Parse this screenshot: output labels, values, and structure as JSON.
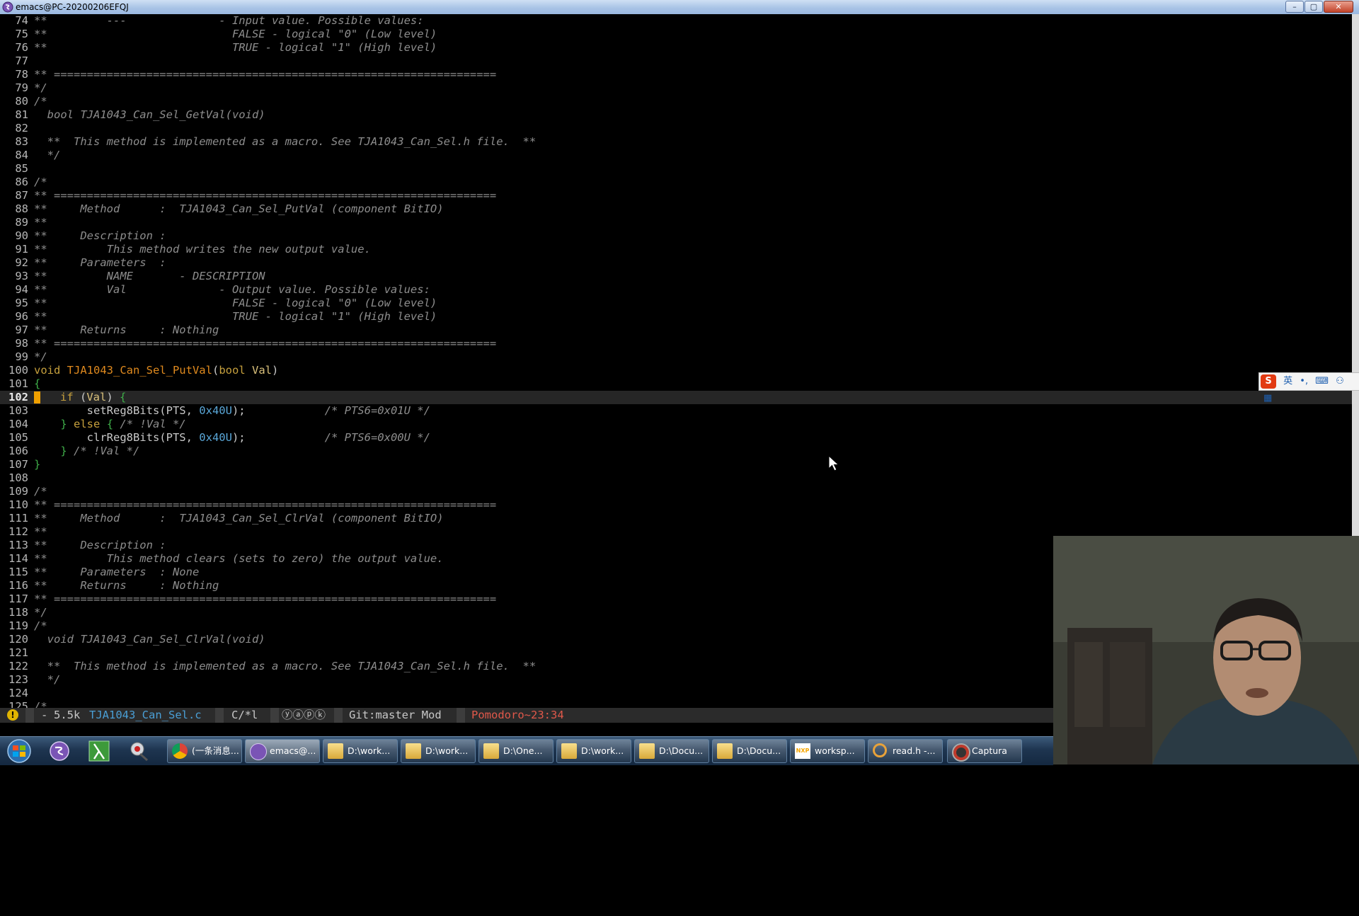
{
  "window": {
    "title": "emacs@PC-20200206EFQJ",
    "controls": {
      "minimize": "–",
      "maximize": "▢",
      "close": "✕"
    }
  },
  "editor": {
    "current_line": 102,
    "lines": [
      {
        "n": "74",
        "t": "**         ---              - Input value. Possible values:"
      },
      {
        "n": "75",
        "t": "**                            FALSE - logical \"0\" (Low level)"
      },
      {
        "n": "76",
        "t": "**                            TRUE - logical \"1\" (High level)"
      },
      {
        "n": "77",
        "t": ""
      },
      {
        "n": "78",
        "t": "** ==================================================================="
      },
      {
        "n": "79",
        "t": "*/"
      },
      {
        "n": "80",
        "t": "/*"
      },
      {
        "n": "81",
        "t": "  bool TJA1043_Can_Sel_GetVal(void)"
      },
      {
        "n": "82",
        "t": ""
      },
      {
        "n": "83",
        "t": "  **  This method is implemented as a macro. See TJA1043_Can_Sel.h file.  **"
      },
      {
        "n": "84",
        "t": "  */"
      },
      {
        "n": "85",
        "t": ""
      },
      {
        "n": "86",
        "t": "/*"
      },
      {
        "n": "87",
        "t": "** ==================================================================="
      },
      {
        "n": "88",
        "t": "**     Method      :  TJA1043_Can_Sel_PutVal (component BitIO)"
      },
      {
        "n": "89",
        "t": "**"
      },
      {
        "n": "90",
        "t": "**     Description :"
      },
      {
        "n": "91",
        "t": "**         This method writes the new output value."
      },
      {
        "n": "92",
        "t": "**     Parameters  :"
      },
      {
        "n": "93",
        "t": "**         NAME       - DESCRIPTION"
      },
      {
        "n": "94",
        "t": "**         Val              - Output value. Possible values:"
      },
      {
        "n": "95",
        "t": "**                            FALSE - logical \"0\" (Low level)"
      },
      {
        "n": "96",
        "t": "**                            TRUE - logical \"1\" (High level)"
      },
      {
        "n": "97",
        "t": "**     Returns     : Nothing"
      },
      {
        "n": "98",
        "t": "** ==================================================================="
      },
      {
        "n": "99",
        "t": "*/"
      },
      {
        "n": "100",
        "t": "void TJA1043_Can_Sel_PutVal(bool Val)"
      },
      {
        "n": "101",
        "t": "{"
      },
      {
        "n": "102",
        "t": "    if (Val) {"
      },
      {
        "n": "103",
        "t": "        setReg8Bits(PTS, 0x40U);            /* PTS6=0x01U */"
      },
      {
        "n": "104",
        "t": "    } else { /* !Val */"
      },
      {
        "n": "105",
        "t": "        clrReg8Bits(PTS, 0x40U);            /* PTS6=0x00U */"
      },
      {
        "n": "106",
        "t": "    } /* !Val */"
      },
      {
        "n": "107",
        "t": "}"
      },
      {
        "n": "108",
        "t": ""
      },
      {
        "n": "109",
        "t": "/*"
      },
      {
        "n": "110",
        "t": "** ==================================================================="
      },
      {
        "n": "111",
        "t": "**     Method      :  TJA1043_Can_Sel_ClrVal (component BitIO)"
      },
      {
        "n": "112",
        "t": "**"
      },
      {
        "n": "113",
        "t": "**     Description :"
      },
      {
        "n": "114",
        "t": "**         This method clears (sets to zero) the output value."
      },
      {
        "n": "115",
        "t": "**     Parameters  : None"
      },
      {
        "n": "116",
        "t": "**     Returns     : Nothing"
      },
      {
        "n": "117",
        "t": "** ==================================================================="
      },
      {
        "n": "118",
        "t": "*/"
      },
      {
        "n": "119",
        "t": "/*"
      },
      {
        "n": "120",
        "t": "  void TJA1043_Can_Sel_ClrVal(void)"
      },
      {
        "n": "121",
        "t": ""
      },
      {
        "n": "122",
        "t": "  **  This method is implemented as a macro. See TJA1043_Can_Sel.h file.  **"
      },
      {
        "n": "123",
        "t": "  */"
      },
      {
        "n": "124",
        "t": ""
      },
      {
        "n": "125",
        "t": "/*"
      }
    ]
  },
  "modeline": {
    "warning": "!",
    "state": "-",
    "size": "5.5k",
    "filename": "TJA1043_Can_Sel.c",
    "mode": "C/*l",
    "minor": "ⓨⓐⓟⓚ",
    "vcs": "Git:master Mod",
    "pomodoro": "Pomodoro~23:34",
    "colors": {
      "filename": "#4a9fd6",
      "pomodoro": "#e0584a"
    }
  },
  "ime": {
    "lang": "英",
    "punct": "•,",
    "keyboard": "⌨",
    "user": "⚇",
    "menu": "▦"
  },
  "taskbar": {
    "tasks": [
      {
        "label": "(一条消息...",
        "icon": "chrome-icon"
      },
      {
        "label": "emacs@...",
        "icon": "emacs-icon",
        "active": true
      },
      {
        "label": "D:\\work...",
        "icon": "folder-icon"
      },
      {
        "label": "D:\\work...",
        "icon": "folder-icon"
      },
      {
        "label": "D:\\One...",
        "icon": "folder-icon"
      },
      {
        "label": "D:\\work...",
        "icon": "folder-icon"
      },
      {
        "label": "D:\\Docu...",
        "icon": "folder-icon"
      },
      {
        "label": "D:\\Docu...",
        "icon": "folder-icon"
      },
      {
        "label": "worksp...",
        "icon": "nxp-icon"
      },
      {
        "label": "read.h -...",
        "icon": "search-icon"
      },
      {
        "label": "Captura",
        "icon": "captura-icon"
      }
    ],
    "nxp_logo": "NXP"
  }
}
